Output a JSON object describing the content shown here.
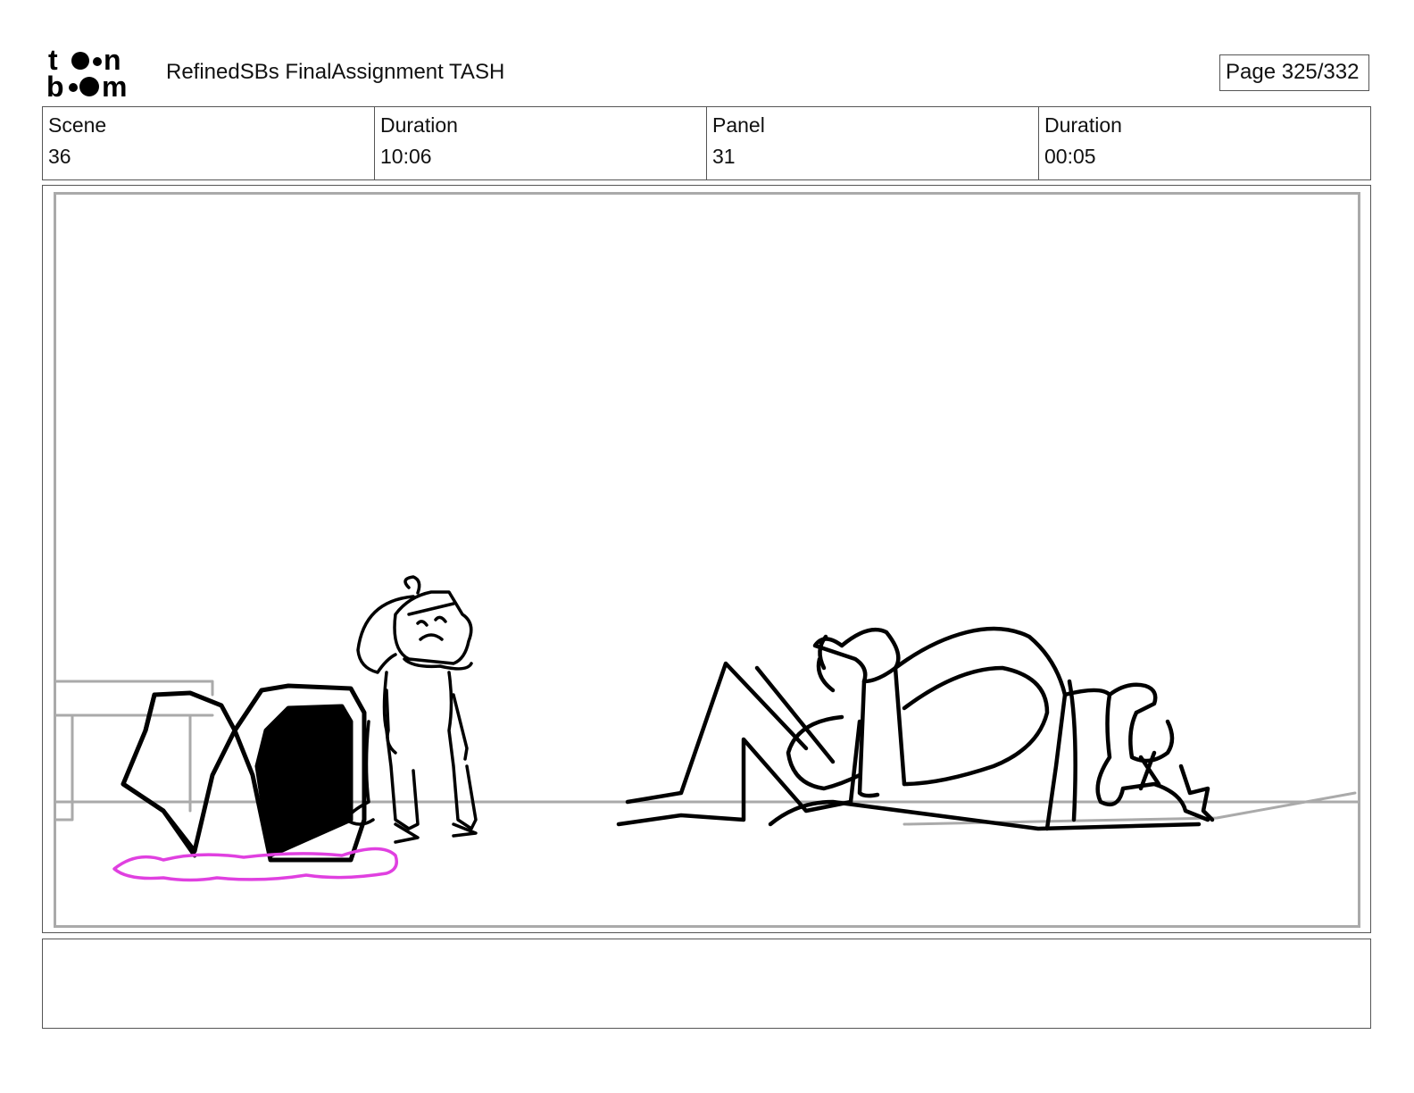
{
  "header": {
    "logo_text": "toon boom",
    "document_title": "RefinedSBs FinalAssignment TASH",
    "page_indicator": "Page 325/332"
  },
  "info": {
    "scene_label": "Scene",
    "scene_value": "36",
    "scene_duration_label": "Duration",
    "scene_duration_value": "10:06",
    "panel_label": "Panel",
    "panel_value": "31",
    "panel_duration_label": "Duration",
    "panel_duration_value": "00:05"
  },
  "panel": {
    "sketch_line_color": "#000000",
    "guide_line_color": "#aaaaaa",
    "puddle_color": "#e040e0"
  },
  "notes": {
    "text": ""
  }
}
